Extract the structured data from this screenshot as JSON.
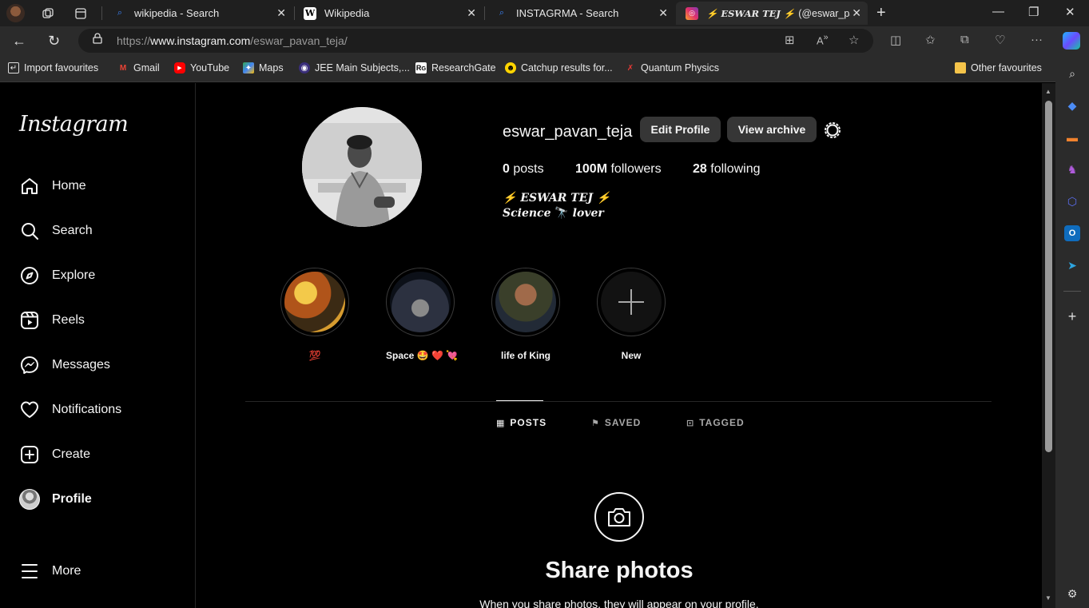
{
  "browser": {
    "tabs": [
      {
        "title": "wikipedia - Search",
        "favicon": "bing-icon"
      },
      {
        "title": "Wikipedia",
        "favicon": "wikipedia-icon"
      },
      {
        "title": "INSTAGRMA - Search",
        "favicon": "bing-icon"
      },
      {
        "title_prefix": "ESWAR TEJ",
        "title_suffix": "(@eswar_pav",
        "favicon": "instagram-icon",
        "active": true
      }
    ],
    "url_prefix": "https://",
    "url_host": "www.instagram.com",
    "url_path": "/eswar_pavan_teja/",
    "favourites": [
      "Import favourites",
      "Gmail",
      "YouTube",
      "Maps",
      "JEE Main Subjects,...",
      "ResearchGate",
      "Catchup results for...",
      "Quantum Physics"
    ],
    "other_favourites": "Other favourites"
  },
  "instagram": {
    "logo": "Instagram",
    "nav": [
      "Home",
      "Search",
      "Explore",
      "Reels",
      "Messages",
      "Notifications",
      "Create",
      "Profile",
      "More"
    ],
    "profile": {
      "username": "eswar_pavan_teja",
      "edit_button": "Edit Profile",
      "archive_button": "View archive",
      "posts_count": "0",
      "posts_label": "posts",
      "followers_count": "100M",
      "followers_label": "followers",
      "following_count": "28",
      "following_label": "following",
      "bio_name": "ESWAR TEJ",
      "bio_line2_a": "Science",
      "bio_line2_b": "lover"
    },
    "highlights": [
      {
        "label": "💯"
      },
      {
        "label": "Space 🤩 ❤️ 💘"
      },
      {
        "label": "life of King"
      },
      {
        "label": "New"
      }
    ],
    "tabs": [
      "POSTS",
      "SAVED",
      "TAGGED"
    ],
    "empty_title": "Share photos",
    "empty_subtitle": "When you share photos, they will appear on your profile."
  },
  "colors": {
    "accent_bolt": "#ff8a00",
    "button_bg": "#363636",
    "browser_chrome": "#2b2b2b"
  }
}
